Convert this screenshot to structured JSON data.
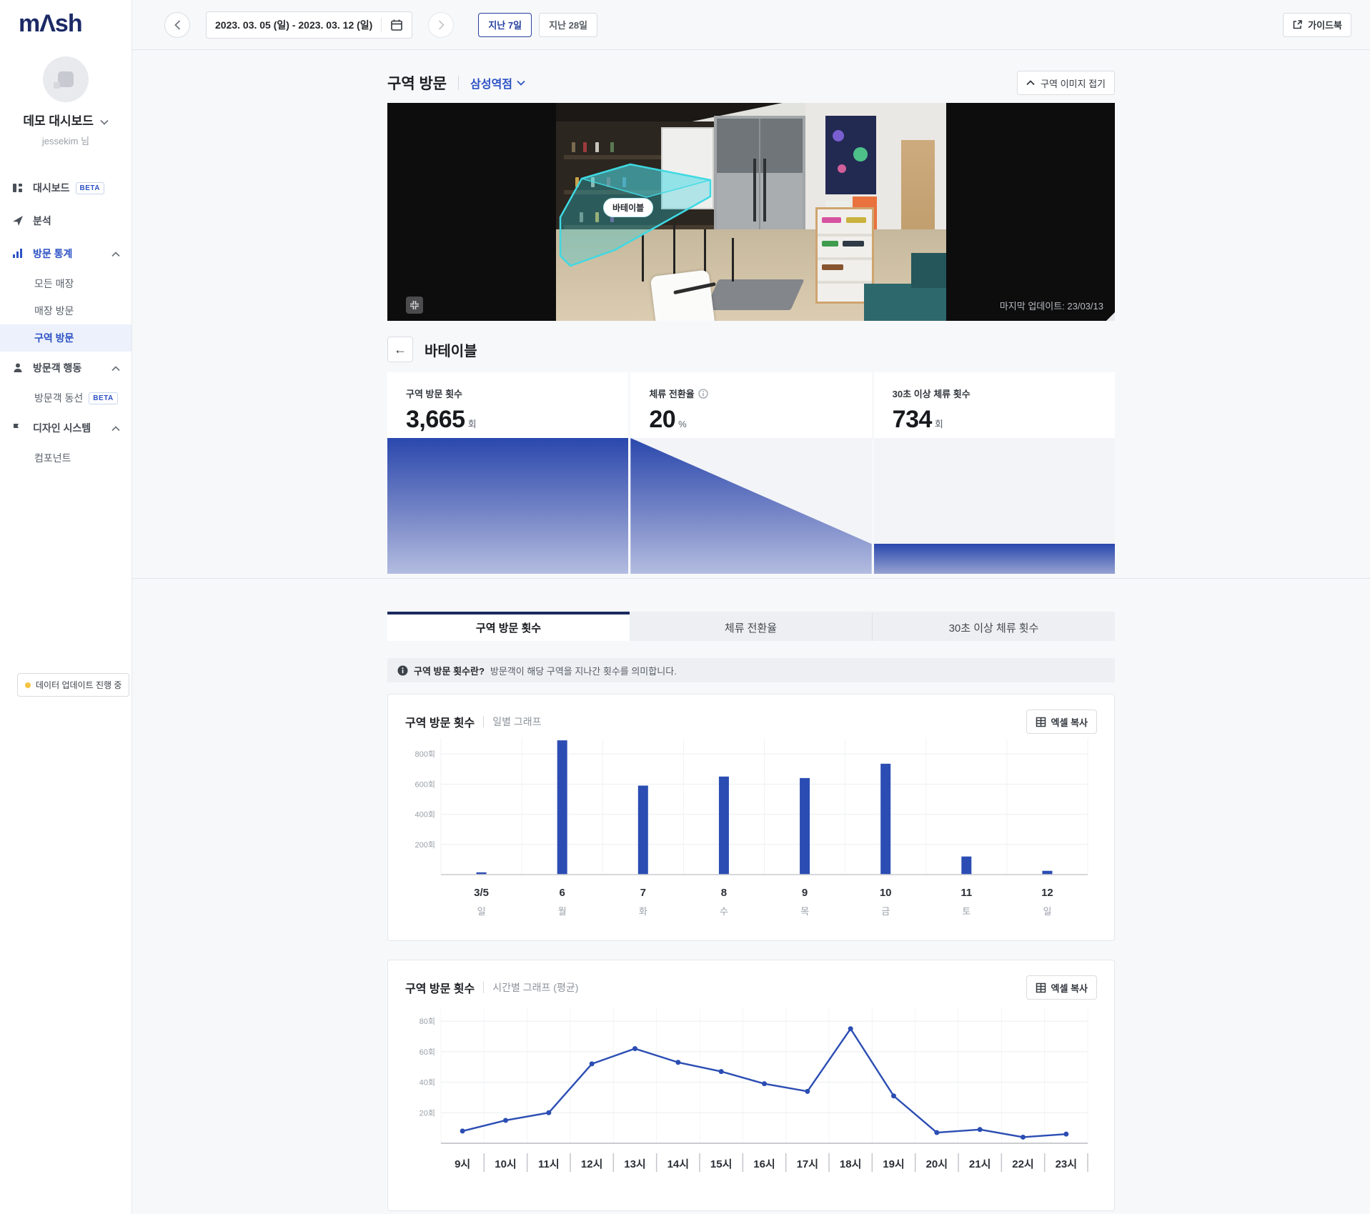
{
  "brand": {
    "logo": "mΛsh"
  },
  "colors": {
    "primary": "#2b4db3",
    "navy": "#1c2b5e",
    "accent_cyan": "#3fd9e3",
    "status_yellow": "#f6c344",
    "link_blue": "#2c52c5"
  },
  "sidebar": {
    "workspace": "데모 대시보드",
    "user": "jessekim 님",
    "beta": "BETA",
    "dashboard": "대시보드",
    "analysis": "분석",
    "visit_stats": "방문 통계",
    "all_stores": "모든 매장",
    "store_visits": "매장 방문",
    "zone_visits": "구역 방문",
    "visitor_behavior": "방문객 행동",
    "visitor_paths": "방문객 동선",
    "design_system": "디자인 시스템",
    "components": "컴포넌트",
    "status": "데이터 업데이트 진행 중"
  },
  "topbar": {
    "date_range": "2023. 03. 05 (일) - 2023. 03. 12 (일)",
    "last7": "지난 7일",
    "last28": "지난 28일",
    "guidebook": "가이드북"
  },
  "header": {
    "title": "구역 방문",
    "store": "삼성역점",
    "collapse_btn": "구역 이미지 접기"
  },
  "video": {
    "zone_label": "바테이블",
    "last_update": "마지막 업데이트: 23/03/13"
  },
  "zone": {
    "back_title": "바테이블"
  },
  "stats": {
    "0": {
      "label": "구역 방문 횟수",
      "value": "3,665",
      "unit": "회"
    },
    "1": {
      "label": "체류 전환율",
      "value": "20",
      "unit": "%"
    },
    "2": {
      "label": "30초 이상 체류 횟수",
      "value": "734",
      "unit": "회"
    }
  },
  "funnel": {
    "start_pct": 100,
    "end_pct": 22
  },
  "tabs": {
    "0": {
      "label": "구역 방문 횟수",
      "active": true
    },
    "1": {
      "label": "체류 전환율",
      "active": false
    },
    "2": {
      "label": "30초 이상 체류 횟수",
      "active": false
    }
  },
  "info_note": {
    "bold": "구역 방문 횟수란?",
    "text": "방문객이 해당 구역을 지나간 횟수를 의미합니다."
  },
  "excel_copy": "엑셀 복사",
  "chart_data": [
    {
      "type": "bar",
      "title": "구역 방문 횟수",
      "subtitle": "일별 그래프",
      "categories": [
        "3/5",
        "6",
        "7",
        "8",
        "9",
        "10",
        "11",
        "12"
      ],
      "day_labels": [
        "일",
        "월",
        "화",
        "수",
        "목",
        "금",
        "토",
        "일"
      ],
      "values": [
        15,
        890,
        590,
        650,
        640,
        735,
        120,
        25
      ],
      "ylim": [
        0,
        900
      ],
      "yticks": [
        200,
        400,
        600,
        800
      ],
      "ytick_suffix": "회",
      "bar_color": "#2b4db3",
      "grid": true,
      "legend": "none"
    },
    {
      "type": "line",
      "title": "구역 방문 횟수",
      "subtitle": "시간별 그래프 (평균)",
      "categories": [
        "9시",
        "10시",
        "11시",
        "12시",
        "13시",
        "14시",
        "15시",
        "16시",
        "17시",
        "18시",
        "19시",
        "20시",
        "21시",
        "22시",
        "23시"
      ],
      "values": [
        8,
        15,
        20,
        52,
        62,
        53,
        47,
        39,
        34,
        75,
        31,
        7,
        9,
        4,
        6
      ],
      "ylim": [
        0,
        88
      ],
      "yticks": [
        20,
        40,
        60,
        80
      ],
      "ytick_suffix": "회",
      "line_color": "#2b4db3",
      "grid": true,
      "legend": "none"
    }
  ]
}
